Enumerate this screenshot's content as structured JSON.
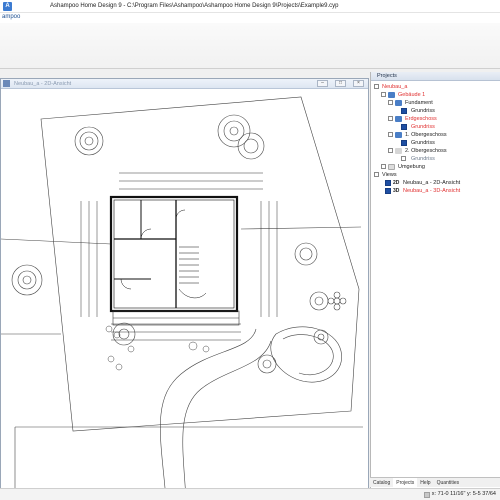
{
  "window": {
    "title": "Ashampoo Home Design 9 - C:\\Program Files\\Ashampoo\\Ashampoo Home Design 9\\Projects\\Example9.cyp"
  },
  "ribbon": {
    "tab_label": "ampoo"
  },
  "document": {
    "title": "Neubau_a - 2D-Ansicht",
    "controls": {
      "minimize": "–",
      "restore": "□",
      "close": "×"
    }
  },
  "panel": {
    "title": "Projects",
    "tree": {
      "root": "Neubau_a",
      "building": "Gebäude 1",
      "floors": [
        {
          "name": "Fundament",
          "plan": "Grundriss",
          "plan_red": false
        },
        {
          "name": "Erdgeschoss",
          "plan": "Grundriss",
          "name_red": true,
          "plan_red": true
        },
        {
          "name": "1. Obergeschoss",
          "plan": "Grundriss",
          "plan_red": false
        },
        {
          "name": "2. Obergeschoss",
          "plan": "Grundriss",
          "plan_red": false
        }
      ],
      "environment": "Umgebung",
      "views_label": "Views",
      "views": [
        {
          "tag": "2D",
          "name": "Neubau_a - 2D-Ansicht",
          "red": false
        },
        {
          "tag": "3D",
          "name": "Neubau_a - 3D-Ansicht",
          "red": true
        }
      ]
    }
  },
  "bottom_tabs": [
    "Catalog",
    "Projects",
    "Help",
    "Quantities"
  ],
  "status": {
    "coordinates": "x: 71-0 11/16\"  y: 5-5 37/64"
  }
}
